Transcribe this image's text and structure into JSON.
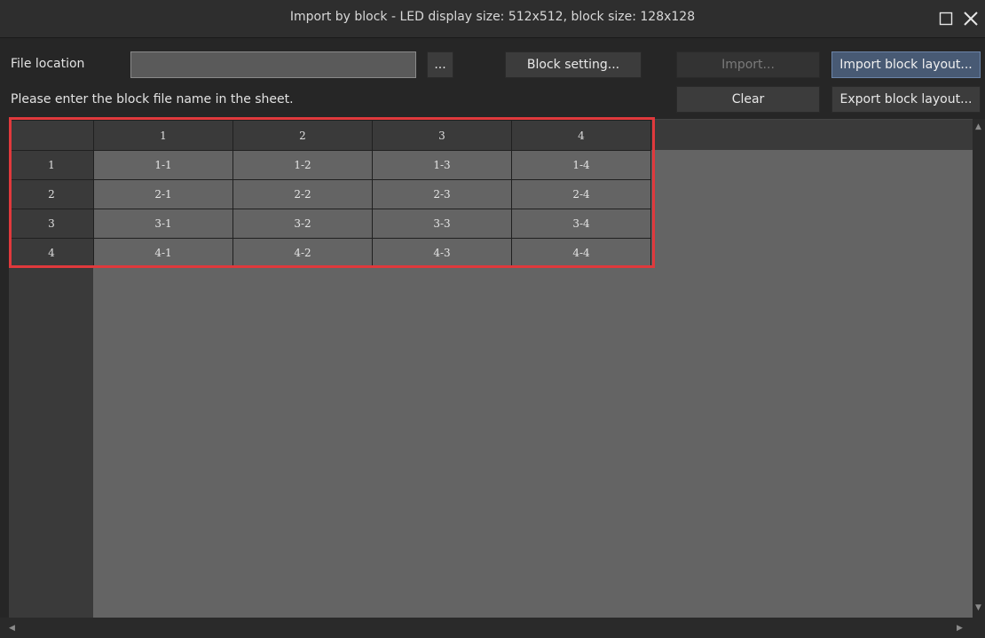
{
  "window": {
    "title": "Import by block - LED display size: 512x512, block size: 128x128"
  },
  "controls": {
    "file_location_label": "File location",
    "file_location_value": "",
    "browse_label": "...",
    "block_setting_label": "Block setting...",
    "import_label": "Import...",
    "import_block_layout_label": "Import block layout...",
    "hint_text": "Please enter the block file name in the sheet.",
    "clear_label": "Clear",
    "export_block_layout_label": "Export block layout..."
  },
  "sheet": {
    "columns": [
      "1",
      "2",
      "3",
      "4"
    ],
    "rows": [
      {
        "header": "1",
        "cells": [
          "1-1",
          "1-2",
          "1-3",
          "1-4"
        ]
      },
      {
        "header": "2",
        "cells": [
          "2-1",
          "2-2",
          "2-3",
          "2-4"
        ]
      },
      {
        "header": "3",
        "cells": [
          "3-1",
          "3-2",
          "3-3",
          "3-4"
        ]
      },
      {
        "header": "4",
        "cells": [
          "4-1",
          "4-2",
          "4-3",
          "4-4"
        ]
      }
    ]
  },
  "icons": {
    "maximize": "maximize-icon",
    "close": "close-icon"
  },
  "colors": {
    "highlight": "#e0393c",
    "active_button": "#485a74"
  }
}
